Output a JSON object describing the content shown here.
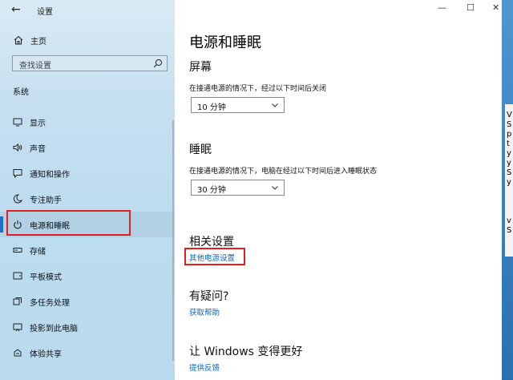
{
  "window": {
    "title": "设置"
  },
  "sidebar": {
    "home": "主页",
    "search_placeholder": "查找设置",
    "section": "系统",
    "items": [
      {
        "label": "显示",
        "icon": "monitor-icon"
      },
      {
        "label": "声音",
        "icon": "speaker-icon"
      },
      {
        "label": "通知和操作",
        "icon": "message-icon"
      },
      {
        "label": "专注助手",
        "icon": "moon-icon"
      },
      {
        "label": "电源和睡眠",
        "icon": "power-icon",
        "selected": true
      },
      {
        "label": "存储",
        "icon": "storage-icon"
      },
      {
        "label": "平板模式",
        "icon": "tablet-icon"
      },
      {
        "label": "多任务处理",
        "icon": "multitask-icon"
      },
      {
        "label": "投影到此电脑",
        "icon": "project-icon"
      },
      {
        "label": "体验共享",
        "icon": "share-icon"
      }
    ]
  },
  "main": {
    "title": "电源和睡眠",
    "screen": {
      "heading": "屏幕",
      "desc": "在接通电源的情况下，经过以下时间后关闭",
      "value": "10 分钟"
    },
    "sleep": {
      "heading": "睡眠",
      "desc": "在接通电源的情况下，电脑在经过以下时间后进入睡眠状态",
      "value": "30 分钟"
    },
    "related": {
      "heading": "相关设置",
      "link": "其他电源设置"
    },
    "question": {
      "heading": "有疑问?",
      "link": "获取帮助"
    },
    "improve": {
      "heading": "让 Windows 变得更好",
      "link": "提供反馈"
    }
  },
  "window_controls": {
    "minimize": "—",
    "maximize": "☐",
    "close": "✕"
  },
  "desktop_strip_text": "V\nS\np\nt\ny\ny\nS\ny\n\n\n\nv\nS"
}
